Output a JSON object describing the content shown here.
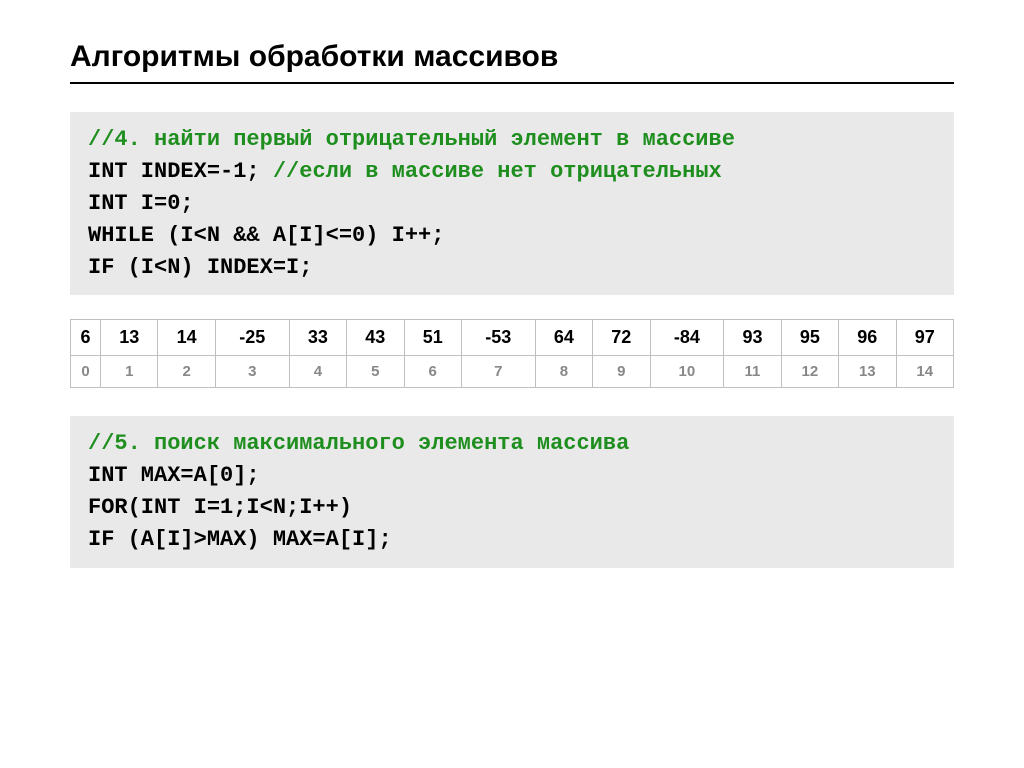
{
  "title": "Алгоритмы обработки массивов",
  "code1": {
    "c1": "//4. найти первый отрицательный элемент в массиве",
    "l2a": "INT INDEX=-1; ",
    "c2": "//если в массиве нет отрицательных",
    "l3": "INT I=0;",
    "l4": "WHILE (I<N && A[I]<=0) I++;",
    "l5": "IF (I<N) INDEX=I;"
  },
  "array": {
    "values": [
      "6",
      "13",
      "14",
      "-25",
      "33",
      "43",
      "51",
      "-53",
      "64",
      "72",
      "-84",
      "93",
      "95",
      "96",
      "97"
    ],
    "indices": [
      "0",
      "1",
      "2",
      "3",
      "4",
      "5",
      "6",
      "7",
      "8",
      "9",
      "10",
      "11",
      "12",
      "13",
      "14"
    ]
  },
  "code2": {
    "c1": "//5. поиск максимального элемента массива",
    "l2": "INT MAX=A[0];",
    "l3": "FOR(INT I=1;I<N;I++)",
    "l4": "IF (A[I]>MAX) MAX=A[I];"
  }
}
